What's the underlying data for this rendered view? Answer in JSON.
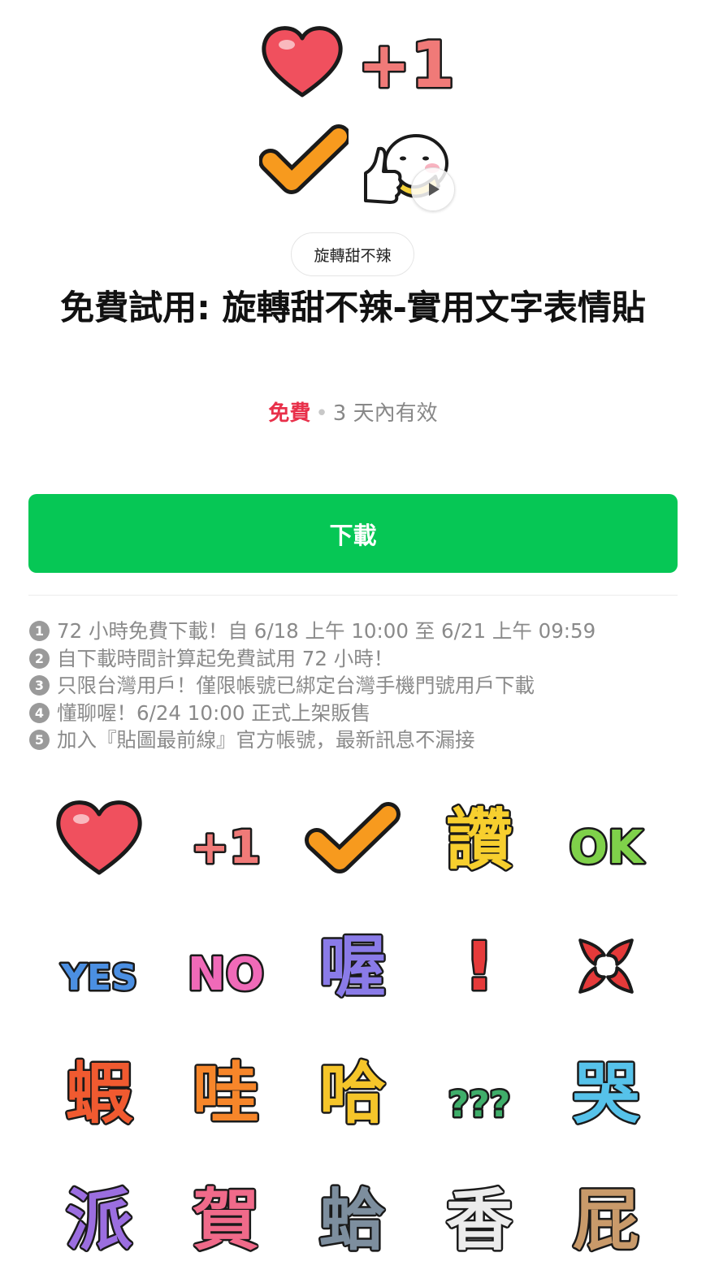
{
  "hero": {
    "stickers": [
      {
        "name": "heart-sticker",
        "text": "",
        "color": "#f0505e"
      },
      {
        "name": "plus-one-sticker",
        "text": "+1",
        "color": "#f07a78"
      },
      {
        "name": "check-sticker",
        "text": "",
        "color": "#f79a1e"
      },
      {
        "name": "thumbs-up-character-sticker",
        "text": "",
        "color": "#f5d23a"
      }
    ]
  },
  "author_tag": "旋轉甜不辣",
  "title": "免費試用: 旋轉甜不辣-實用文字表情貼",
  "price": {
    "label": "免費",
    "separator": "•",
    "validity": "3 天內有效",
    "color": "#e8304a"
  },
  "download_label": "下載",
  "accent_color": "#06c755",
  "notes": [
    {
      "num": "1",
      "text": "72 小時免費下載！自 6/18 上午 10:00 至 6/21 上午 09:59"
    },
    {
      "num": "2",
      "text": "自下載時間計算起免費試用 72 小時！"
    },
    {
      "num": "3",
      "text": "只限台灣用戶！僅限帳號已綁定台灣手機門號用戶下載"
    },
    {
      "num": "4",
      "text": "懂聊喔！6/24 10:00 正式上架販售"
    },
    {
      "num": "5",
      "text": "加入『貼圖最前線』官方帳號，最新訊息不漏接"
    }
  ],
  "grid": [
    {
      "name": "heart",
      "text": "",
      "color": "#f0505e"
    },
    {
      "name": "plus-one",
      "text": "+1",
      "color": "#f07a78"
    },
    {
      "name": "check",
      "text": "",
      "color": "#f79a1e"
    },
    {
      "name": "praise",
      "text": "讚",
      "color": "#f7cf2e"
    },
    {
      "name": "ok",
      "text": "OK",
      "color": "#7fd14a"
    },
    {
      "name": "yes",
      "text": "YES",
      "color": "#4b8fe2"
    },
    {
      "name": "no",
      "text": "NO",
      "color": "#f06ab8"
    },
    {
      "name": "oh",
      "text": "喔",
      "color": "#8a7be8"
    },
    {
      "name": "exclamation",
      "text": "!",
      "color": "#e53a3a"
    },
    {
      "name": "anger",
      "text": "",
      "color": "#e53a3a"
    },
    {
      "name": "shocked",
      "text": "蝦",
      "color": "#f05a30"
    },
    {
      "name": "wow",
      "text": "哇",
      "color": "#f7862a"
    },
    {
      "name": "haha",
      "text": "哈",
      "color": "#f5c52a"
    },
    {
      "name": "question",
      "text": "???",
      "color": "#3fae6a"
    },
    {
      "name": "cry",
      "text": "哭",
      "color": "#56c2ea"
    },
    {
      "name": "party",
      "text": "派",
      "color": "#9b6ee0"
    },
    {
      "name": "congrats",
      "text": "賀",
      "color": "#f06a8a"
    },
    {
      "name": "clam",
      "text": "蛤",
      "color": "#7d8e9e"
    },
    {
      "name": "fragrant",
      "text": "香",
      "color": "#ececec"
    },
    {
      "name": "fart",
      "text": "屁",
      "color": "#c99a6a"
    }
  ]
}
